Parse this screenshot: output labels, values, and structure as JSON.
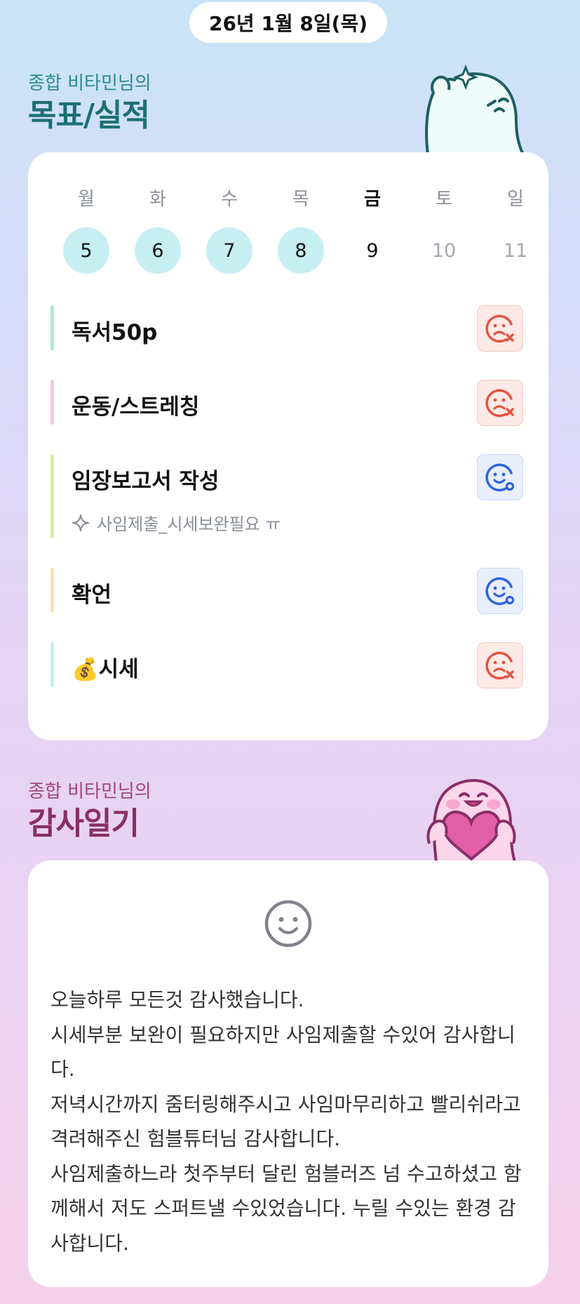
{
  "header": {
    "date": "26년 1월 8일(목)"
  },
  "goals_section": {
    "subtitle": "종합 비타민님의",
    "title": "목표/실적",
    "colors": {
      "subtitle": "#2b8a8f",
      "title": "#1d6f74"
    }
  },
  "week": {
    "days": [
      {
        "name": "월",
        "num": "5",
        "state": "done"
      },
      {
        "name": "화",
        "num": "6",
        "state": "done"
      },
      {
        "name": "수",
        "num": "7",
        "state": "done"
      },
      {
        "name": "목",
        "num": "8",
        "state": "done"
      },
      {
        "name": "금",
        "num": "9",
        "state": "today"
      },
      {
        "name": "토",
        "num": "10",
        "state": "future"
      },
      {
        "name": "일",
        "num": "11",
        "state": "future"
      }
    ]
  },
  "goals": [
    {
      "label": "독서50p",
      "status": "fail",
      "status_icon": "sad-face-x-icon",
      "bar_color": "#aee9d9"
    },
    {
      "label": "운동/스트레칭",
      "status": "fail",
      "status_icon": "sad-face-x-icon",
      "bar_color": "#f7c6e4"
    },
    {
      "label": "임장보고서 작성",
      "memo": "사임제출_시세보완필요 ㅠ",
      "memo_icon": "sparkle-icon",
      "status": "success",
      "status_icon": "happy-face-o-icon",
      "bar_color": "#d5ef9e"
    },
    {
      "label": "확언",
      "status": "success",
      "status_icon": "happy-face-o-icon",
      "bar_color": "#fde0b0"
    },
    {
      "label": "💰시세",
      "status": "fail",
      "status_icon": "sad-face-x-icon",
      "bar_color": "#c4eef2"
    }
  ],
  "diary_section": {
    "subtitle": "종합 비타민님의",
    "title": "감사일기",
    "colors": {
      "subtitle": "#a0487a",
      "title": "#8a2e66"
    },
    "mood_icon": "smile-face-icon",
    "text": [
      "오늘하루 모든것 감사했습니다.",
      "시세부분 보완이 필요하지만 사임제출할 수있어 감사합니다.",
      "저녁시간까지 줌터링해주시고 사임마무리하고 빨리쉬라고 격려해주신 험블튜터님 감사합니다.",
      "사임제출하느라 첫주부터 달린 험블러즈 넘 수고하셨고 함께해서 저도 스퍼트낼 수있었습니다. 누릴 수있는 환경 감사합니다."
    ]
  },
  "colors": {
    "done_day_bg": "#c6eff3",
    "fail": "#e55340",
    "success": "#2d63e0"
  }
}
